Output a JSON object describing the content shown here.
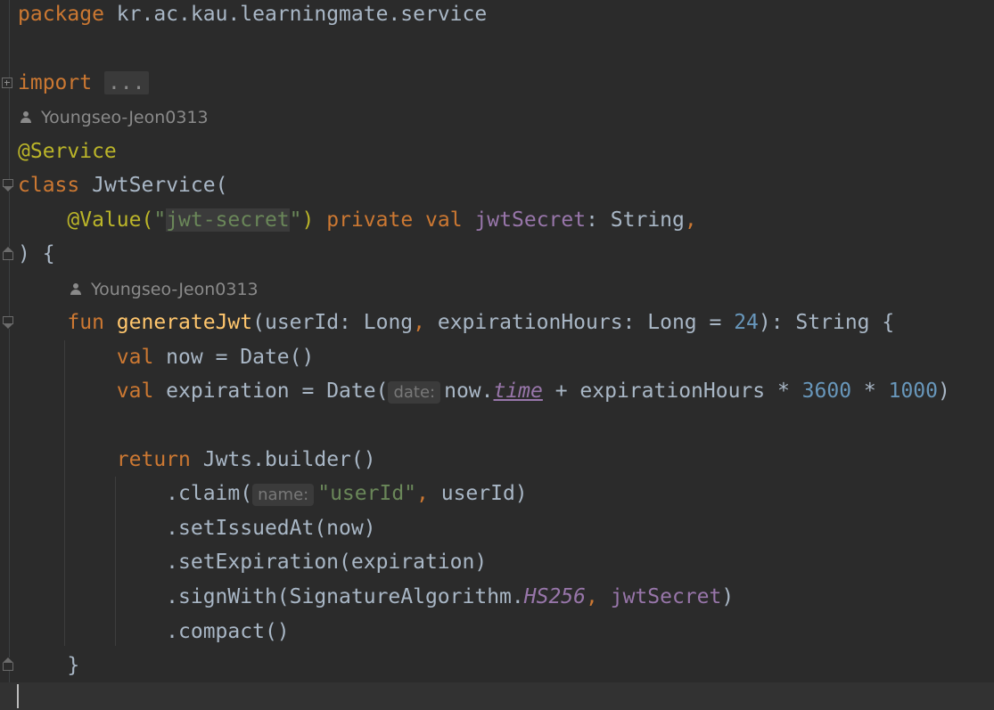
{
  "code": {
    "package_kw": "package",
    "package_name": "kr.ac.kau.learningmate.service",
    "import_kw": "import",
    "import_folded": "...",
    "author_1": "Youngseo-Jeon0313",
    "annotation_service": "@Service",
    "class_kw": "class",
    "class_name": "JwtService(",
    "value_annotation": "@Value(",
    "value_string_open": "\"",
    "value_string_body": "jwt-secret",
    "value_string_close": "\"",
    "value_close": ")",
    "private_kw": "private",
    "val_kw": "val",
    "jwt_secret_prop": "jwtSecret",
    "type_string_comma": ": String",
    "comma": ",",
    "class_close": ") {",
    "author_2": "Youngseo-Jeon0313",
    "fun_kw": "fun",
    "fun_name": "generateJwt",
    "fun_params_1": "(userId: Long",
    "fun_params_2": " expirationHours: Long = ",
    "fun_default": "24",
    "fun_return": "): String {",
    "now_decl": " now = Date()",
    "exp_decl": " expiration = Date(",
    "hint_date": "date:",
    "now_dot": "now.",
    "time_prop": "time",
    "exp_mid": " + expirationHours * ",
    "num_3600": "3600",
    "mul": " * ",
    "num_1000": "1000",
    "close_paren": ")",
    "return_kw": "return",
    "builder": " Jwts.builder()",
    "claim_open": ".claim(",
    "hint_name": "name:",
    "claim_key": "\"userId\"",
    "claim_rest": " userId)",
    "set_issued": ".setIssuedAt(now)",
    "set_exp": ".setExpiration(expiration)",
    "sign_open": ".signWith(SignatureAlgorithm.",
    "hs256": "HS256",
    "sign_secret": "jwtSecret",
    "compact": ".compact()",
    "close_brace": "}"
  },
  "colors": {
    "background": "#2b2b2b",
    "keyword": "#cc7832",
    "annotation": "#bbb529",
    "string": "#6a8759",
    "number": "#6897bb",
    "function": "#ffc66d",
    "property": "#9876aa",
    "default_text": "#a9b7c6"
  }
}
